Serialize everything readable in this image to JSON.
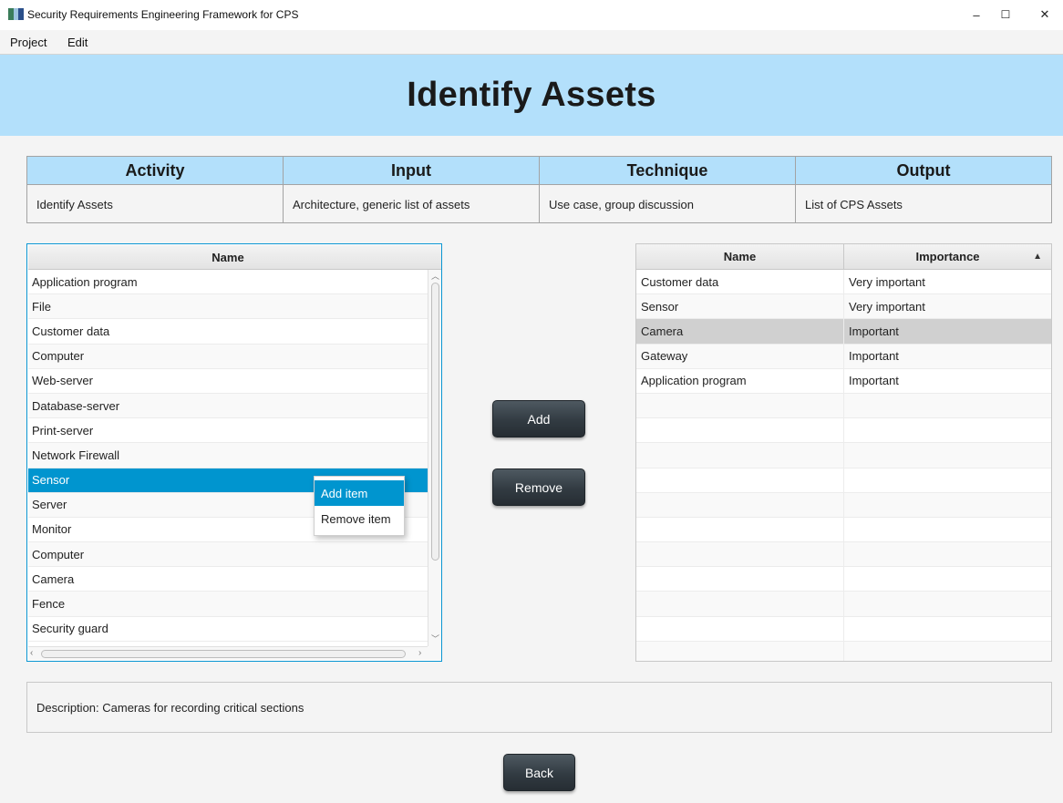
{
  "window": {
    "title": "Security Requirements Engineering Framework for CPS",
    "minimize": "–",
    "maximize": "☐",
    "close": "✕"
  },
  "menu": [
    "Project",
    "Edit"
  ],
  "page_title": "Identify Assets",
  "info_table": {
    "headers": [
      "Activity",
      "Input",
      "Technique",
      "Output"
    ],
    "values": [
      "Identify Assets",
      "Architecture, generic list of assets",
      "Use case, group discussion",
      "List of CPS Assets"
    ]
  },
  "asset_list": {
    "header": "Name",
    "items": [
      "Application program",
      "File",
      "Customer data",
      "Computer",
      "Web-server",
      "Database-server",
      "Print-server",
      "Network Firewall",
      "Sensor",
      "Server",
      "Monitor",
      "Computer",
      "Camera",
      "Fence",
      "Security guard"
    ],
    "selected_index": 8
  },
  "context_menu": {
    "items": [
      "Add item",
      "Remove item"
    ],
    "highlighted_index": 0
  },
  "buttons": {
    "add": "Add",
    "remove": "Remove",
    "back": "Back"
  },
  "selected_assets": {
    "headers": [
      "Name",
      "Importance"
    ],
    "sort_indicator": "▲",
    "rows": [
      {
        "name": "Customer data",
        "importance": "Very important"
      },
      {
        "name": "Sensor",
        "importance": "Very important"
      },
      {
        "name": "Camera",
        "importance": "Important"
      },
      {
        "name": "Gateway",
        "importance": "Important"
      },
      {
        "name": "Application program",
        "importance": "Important"
      }
    ],
    "selected_index": 2,
    "empty_rows": 11
  },
  "description": "Description: Cameras for recording critical sections",
  "colors": {
    "banner": "#b3e0fb",
    "selection": "#0095cf",
    "button_dark": "#323b42"
  }
}
